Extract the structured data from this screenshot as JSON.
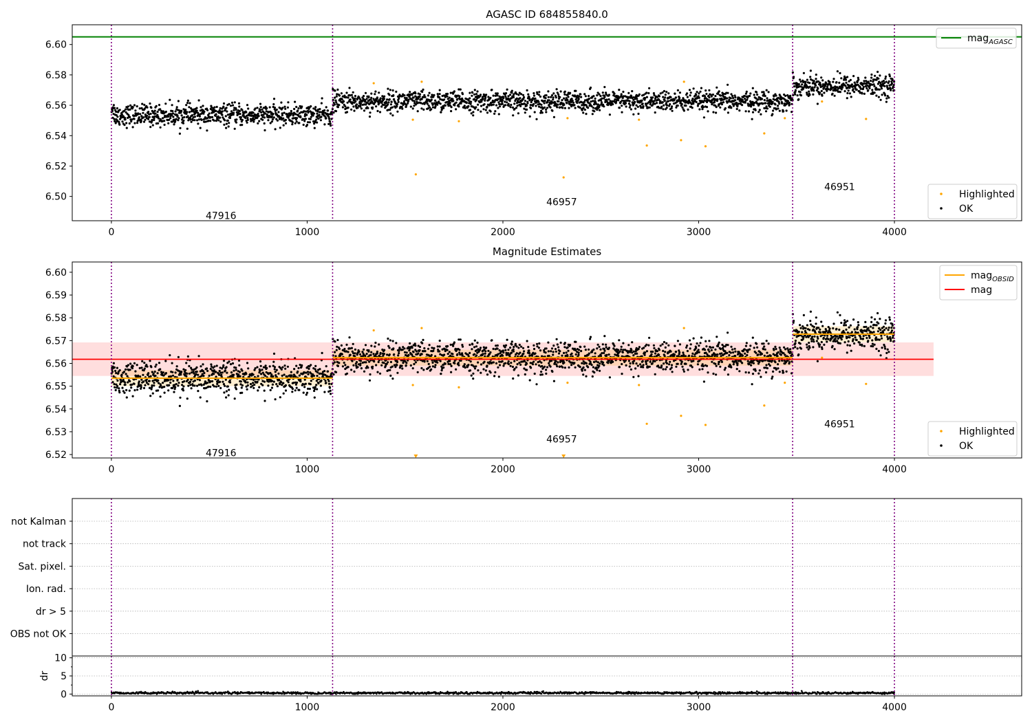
{
  "chart_data": [
    {
      "type": "scatter",
      "title": "AGASC ID 684855840.0",
      "x_ticks": [
        0,
        1000,
        2000,
        3000,
        4000
      ],
      "y_ticks": [
        "6.50",
        "6.52",
        "6.54",
        "6.56",
        "6.58",
        "6.60"
      ],
      "xlim": [
        -200,
        4650
      ],
      "ylim": [
        6.484,
        6.613
      ],
      "observations": [
        {
          "label": "47916",
          "x_start": 0,
          "x_end": 1130,
          "mean": 6.5535,
          "std": 0.0035,
          "label_x": 560,
          "label_y": 6.4875
        },
        {
          "label": "46957",
          "x_start": 1130,
          "x_end": 3480,
          "mean": 6.5625,
          "std": 0.0035,
          "label_x": 2300,
          "label_y": 6.4965
        },
        {
          "label": "46951",
          "x_start": 3480,
          "x_end": 4000,
          "mean": 6.5728,
          "std": 0.0035,
          "label_x": 3720,
          "label_y": 6.5065
        }
      ],
      "boundaries": [
        0,
        1130,
        3480,
        4000
      ],
      "reference_lines": [
        {
          "name": "mag_AGASC",
          "value": 6.605,
          "color": "#008000"
        }
      ],
      "highlighted_points": [
        [
          1340,
          6.5745
        ],
        [
          1540,
          6.5505
        ],
        [
          1555,
          6.5145
        ],
        [
          1585,
          6.5755
        ],
        [
          1775,
          6.5495
        ],
        [
          2310,
          6.5125
        ],
        [
          2330,
          6.5515
        ],
        [
          2695,
          6.5505
        ],
        [
          2735,
          6.5335
        ],
        [
          2910,
          6.537
        ],
        [
          2925,
          6.5755
        ],
        [
          3035,
          6.533
        ],
        [
          3335,
          6.5415
        ],
        [
          3440,
          6.5515
        ],
        [
          3630,
          6.5625
        ],
        [
          3855,
          6.551
        ]
      ],
      "legends": [
        {
          "items": [
            {
              "label": "mag",
              "sub": "AGASC",
              "kind": "line",
              "color": "#008000"
            }
          ]
        },
        {
          "items": [
            {
              "label": "Highlighted",
              "kind": "point",
              "color": "#ffa500"
            },
            {
              "label": "OK",
              "kind": "point",
              "color": "#000000"
            }
          ]
        }
      ],
      "grid": false
    },
    {
      "type": "scatter",
      "title": "Magnitude Estimates",
      "x_ticks": [
        0,
        1000,
        2000,
        3000,
        4000
      ],
      "y_ticks": [
        "6.52",
        "6.53",
        "6.54",
        "6.55",
        "6.56",
        "6.57",
        "6.58",
        "6.59",
        "6.60"
      ],
      "xlim": [
        -200,
        4650
      ],
      "ylim": [
        6.5185,
        6.6045
      ],
      "mag": {
        "value": 6.5618,
        "band": [
          6.5545,
          6.5692
        ],
        "x_range": [
          -200,
          4200
        ],
        "color": "#ff0000"
      },
      "obsid_mag_color": "#ffa500",
      "off_scale_markers": [
        1555,
        2310
      ],
      "legends": [
        {
          "items": [
            {
              "label": "mag",
              "sub": "OBSID",
              "kind": "line",
              "color": "#ffa500"
            },
            {
              "label": "mag",
              "kind": "line",
              "color": "#ff0000"
            }
          ]
        },
        {
          "items": [
            {
              "label": "Highlighted",
              "kind": "point",
              "color": "#ffa500"
            },
            {
              "label": "OK",
              "kind": "point",
              "color": "#000000"
            }
          ]
        }
      ],
      "grid": false
    },
    {
      "type": "scatter",
      "title": "",
      "flags": [
        "not Kalman",
        "not track",
        "Sat. pixel.",
        "Ion. rad.",
        "dr > 5",
        "OBS not OK"
      ],
      "flag_grid": "dotted",
      "x_ticks": [
        0,
        1000,
        2000,
        3000,
        4000
      ],
      "xlim": [
        -200,
        4650
      ]
    },
    {
      "type": "scatter",
      "title": "",
      "ylabel": "dr",
      "y_ticks": [
        "0",
        "5",
        "10"
      ],
      "ylim": [
        -0.5,
        10.5
      ],
      "x_ticks": [
        0,
        1000,
        2000,
        3000,
        4000
      ],
      "xlim": [
        -200,
        4650
      ],
      "dr_typical": 0.3,
      "grid": "dotted"
    }
  ]
}
